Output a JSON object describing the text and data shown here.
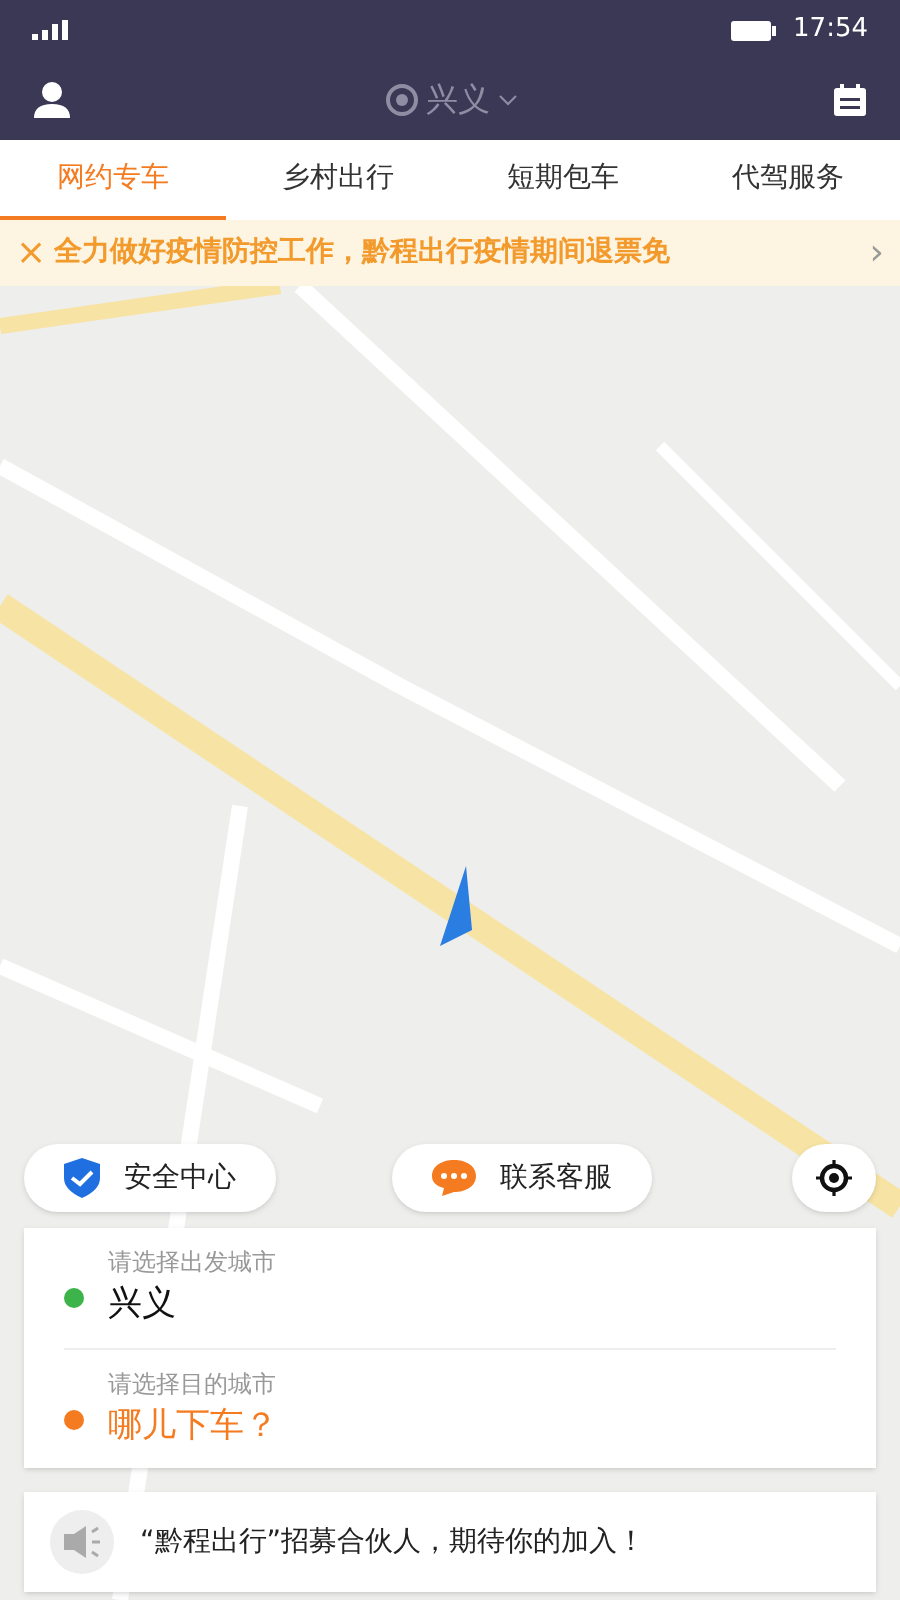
{
  "status_bar": {
    "time": "17:54"
  },
  "header": {
    "city": "兴义"
  },
  "tabs": [
    {
      "label": "网约专车",
      "selected": true
    },
    {
      "label": "乡村出行",
      "selected": false
    },
    {
      "label": "短期包车",
      "selected": false
    },
    {
      "label": "代驾服务",
      "selected": false
    }
  ],
  "notice": {
    "close": "×",
    "text": "全力做好疫情防控工作，黔程出行疫情期间退票免",
    "more": "›"
  },
  "map_buttons": [
    {
      "kind": "safety",
      "label": "安全中心"
    },
    {
      "kind": "service",
      "label": "联系客服"
    }
  ],
  "trip": {
    "origin": {
      "placeholder": "请选择出发城市",
      "value": "兴义",
      "color": "#3cb44a"
    },
    "destination": {
      "placeholder": "请选择目的城市",
      "value": "哪儿下车？",
      "color": "#f47b20"
    }
  },
  "banner": {
    "text": "“黔程出行”招募合伙人，期待你的加入！"
  }
}
